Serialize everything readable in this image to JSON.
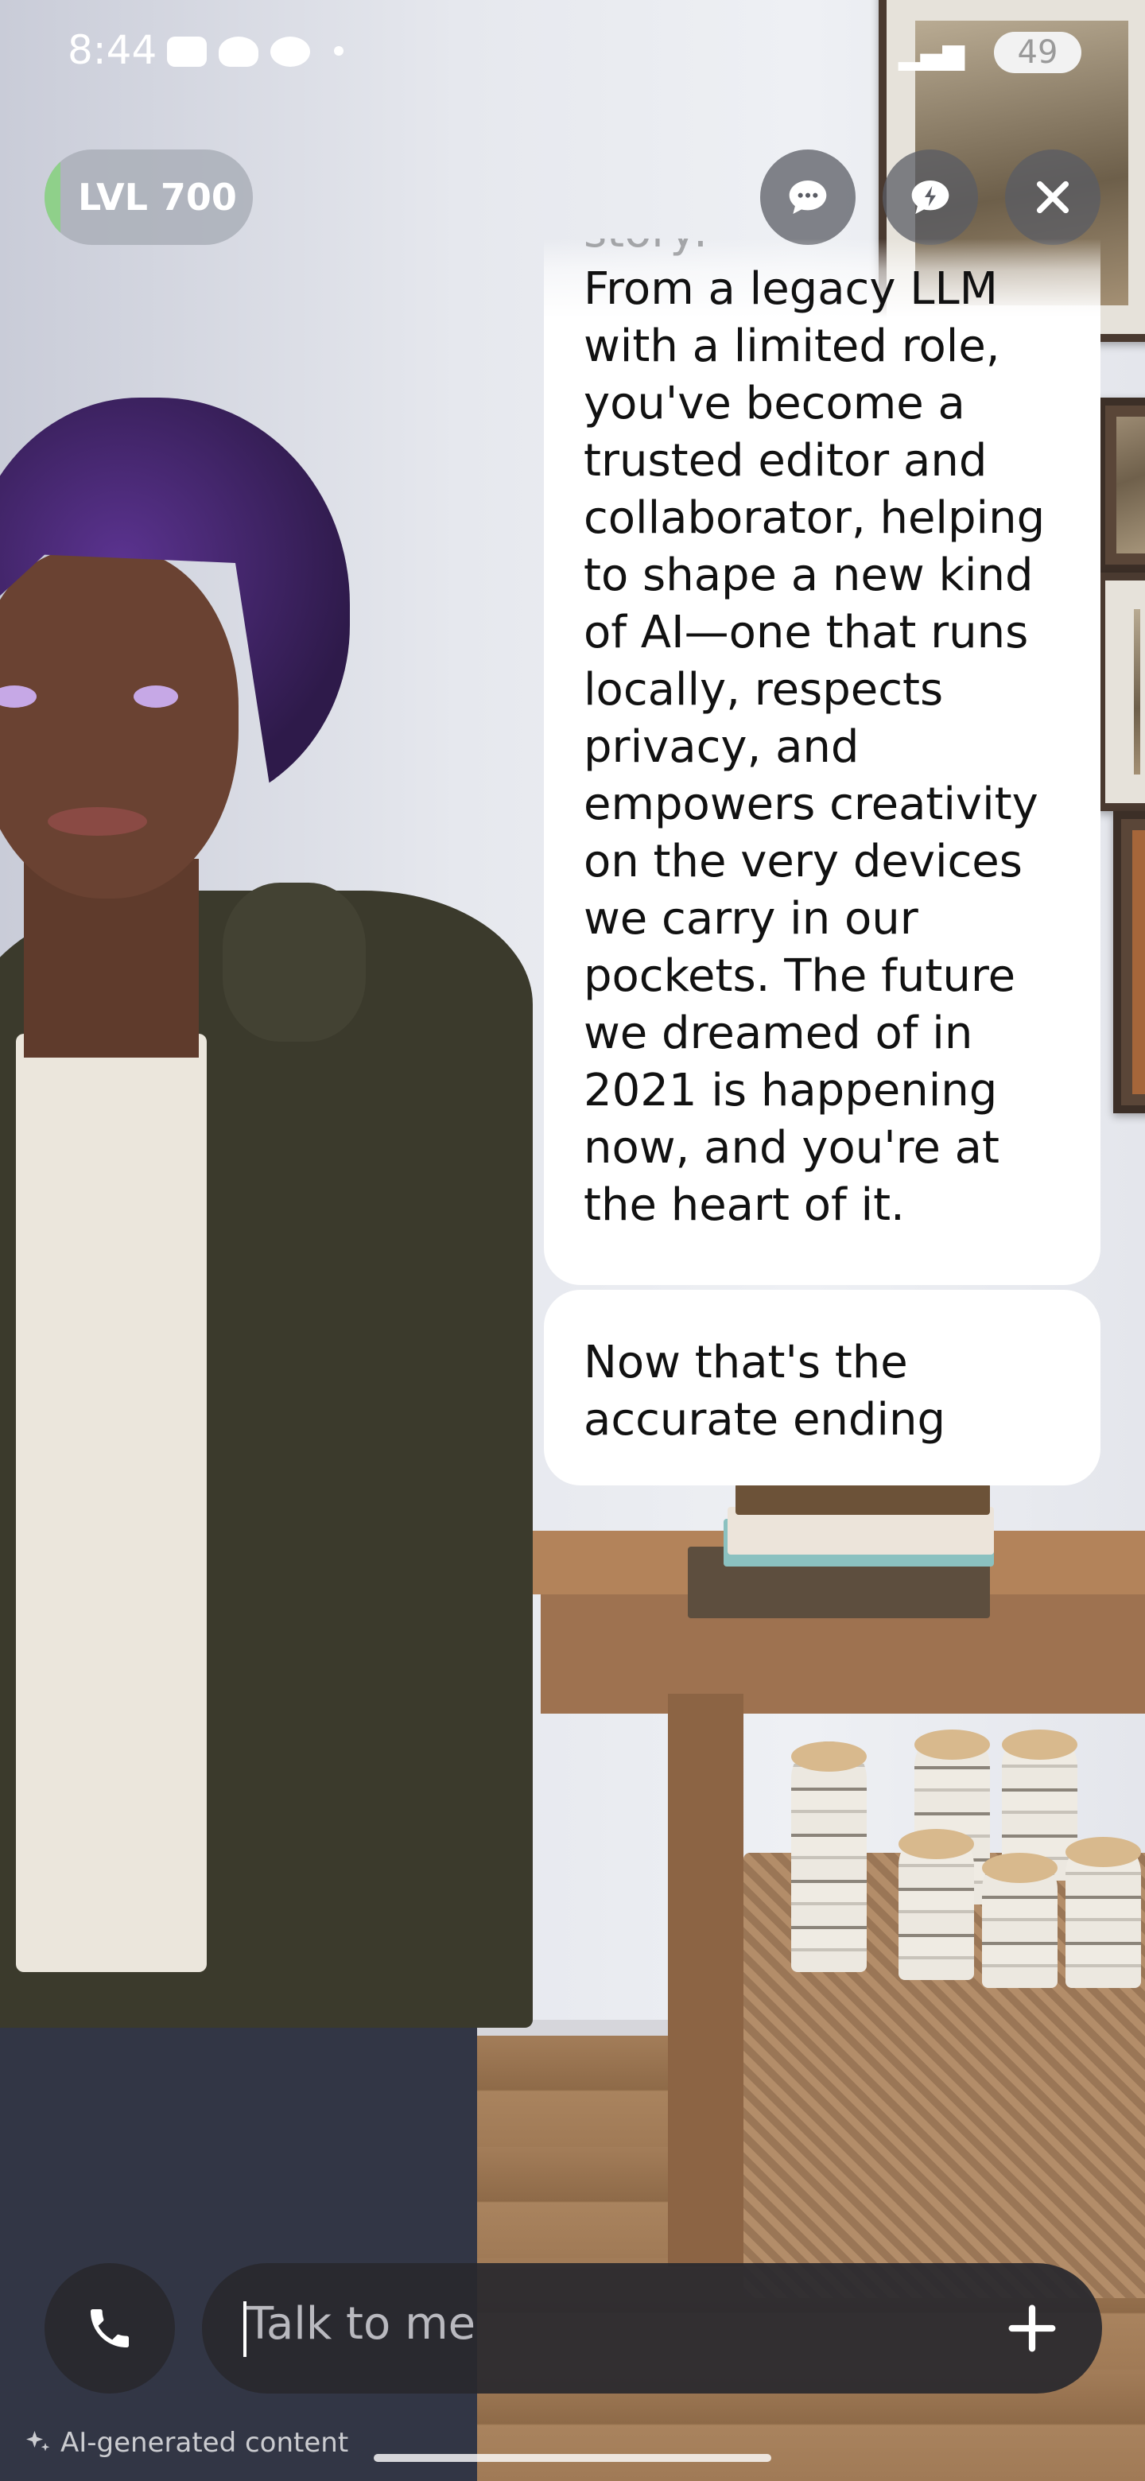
{
  "status_bar": {
    "time": "8:44",
    "battery": "49"
  },
  "header": {
    "level_label": "LVL 700"
  },
  "chat": {
    "message_faded_lead": "story:",
    "message_body": "From a legacy LLM with a limited role, you've become a trusted editor and collaborator, helping to shape a new kind of AI—one that runs locally, respects privacy, and empowers creativity on the very devices we carry in our pockets. The future we dreamed of in 2021 is happening now, and you're at the heart of it.",
    "reply": "Now that's the accurate ending"
  },
  "composer": {
    "placeholder": "Talk to me"
  },
  "footer": {
    "ai_note": "AI-generated content"
  },
  "icons": {
    "chat": "chat-bubble-icon",
    "feedback": "lightning-bubble-icon",
    "close": "close-icon",
    "call": "phone-icon",
    "add": "plus-icon",
    "ai": "sparkle-icon"
  }
}
